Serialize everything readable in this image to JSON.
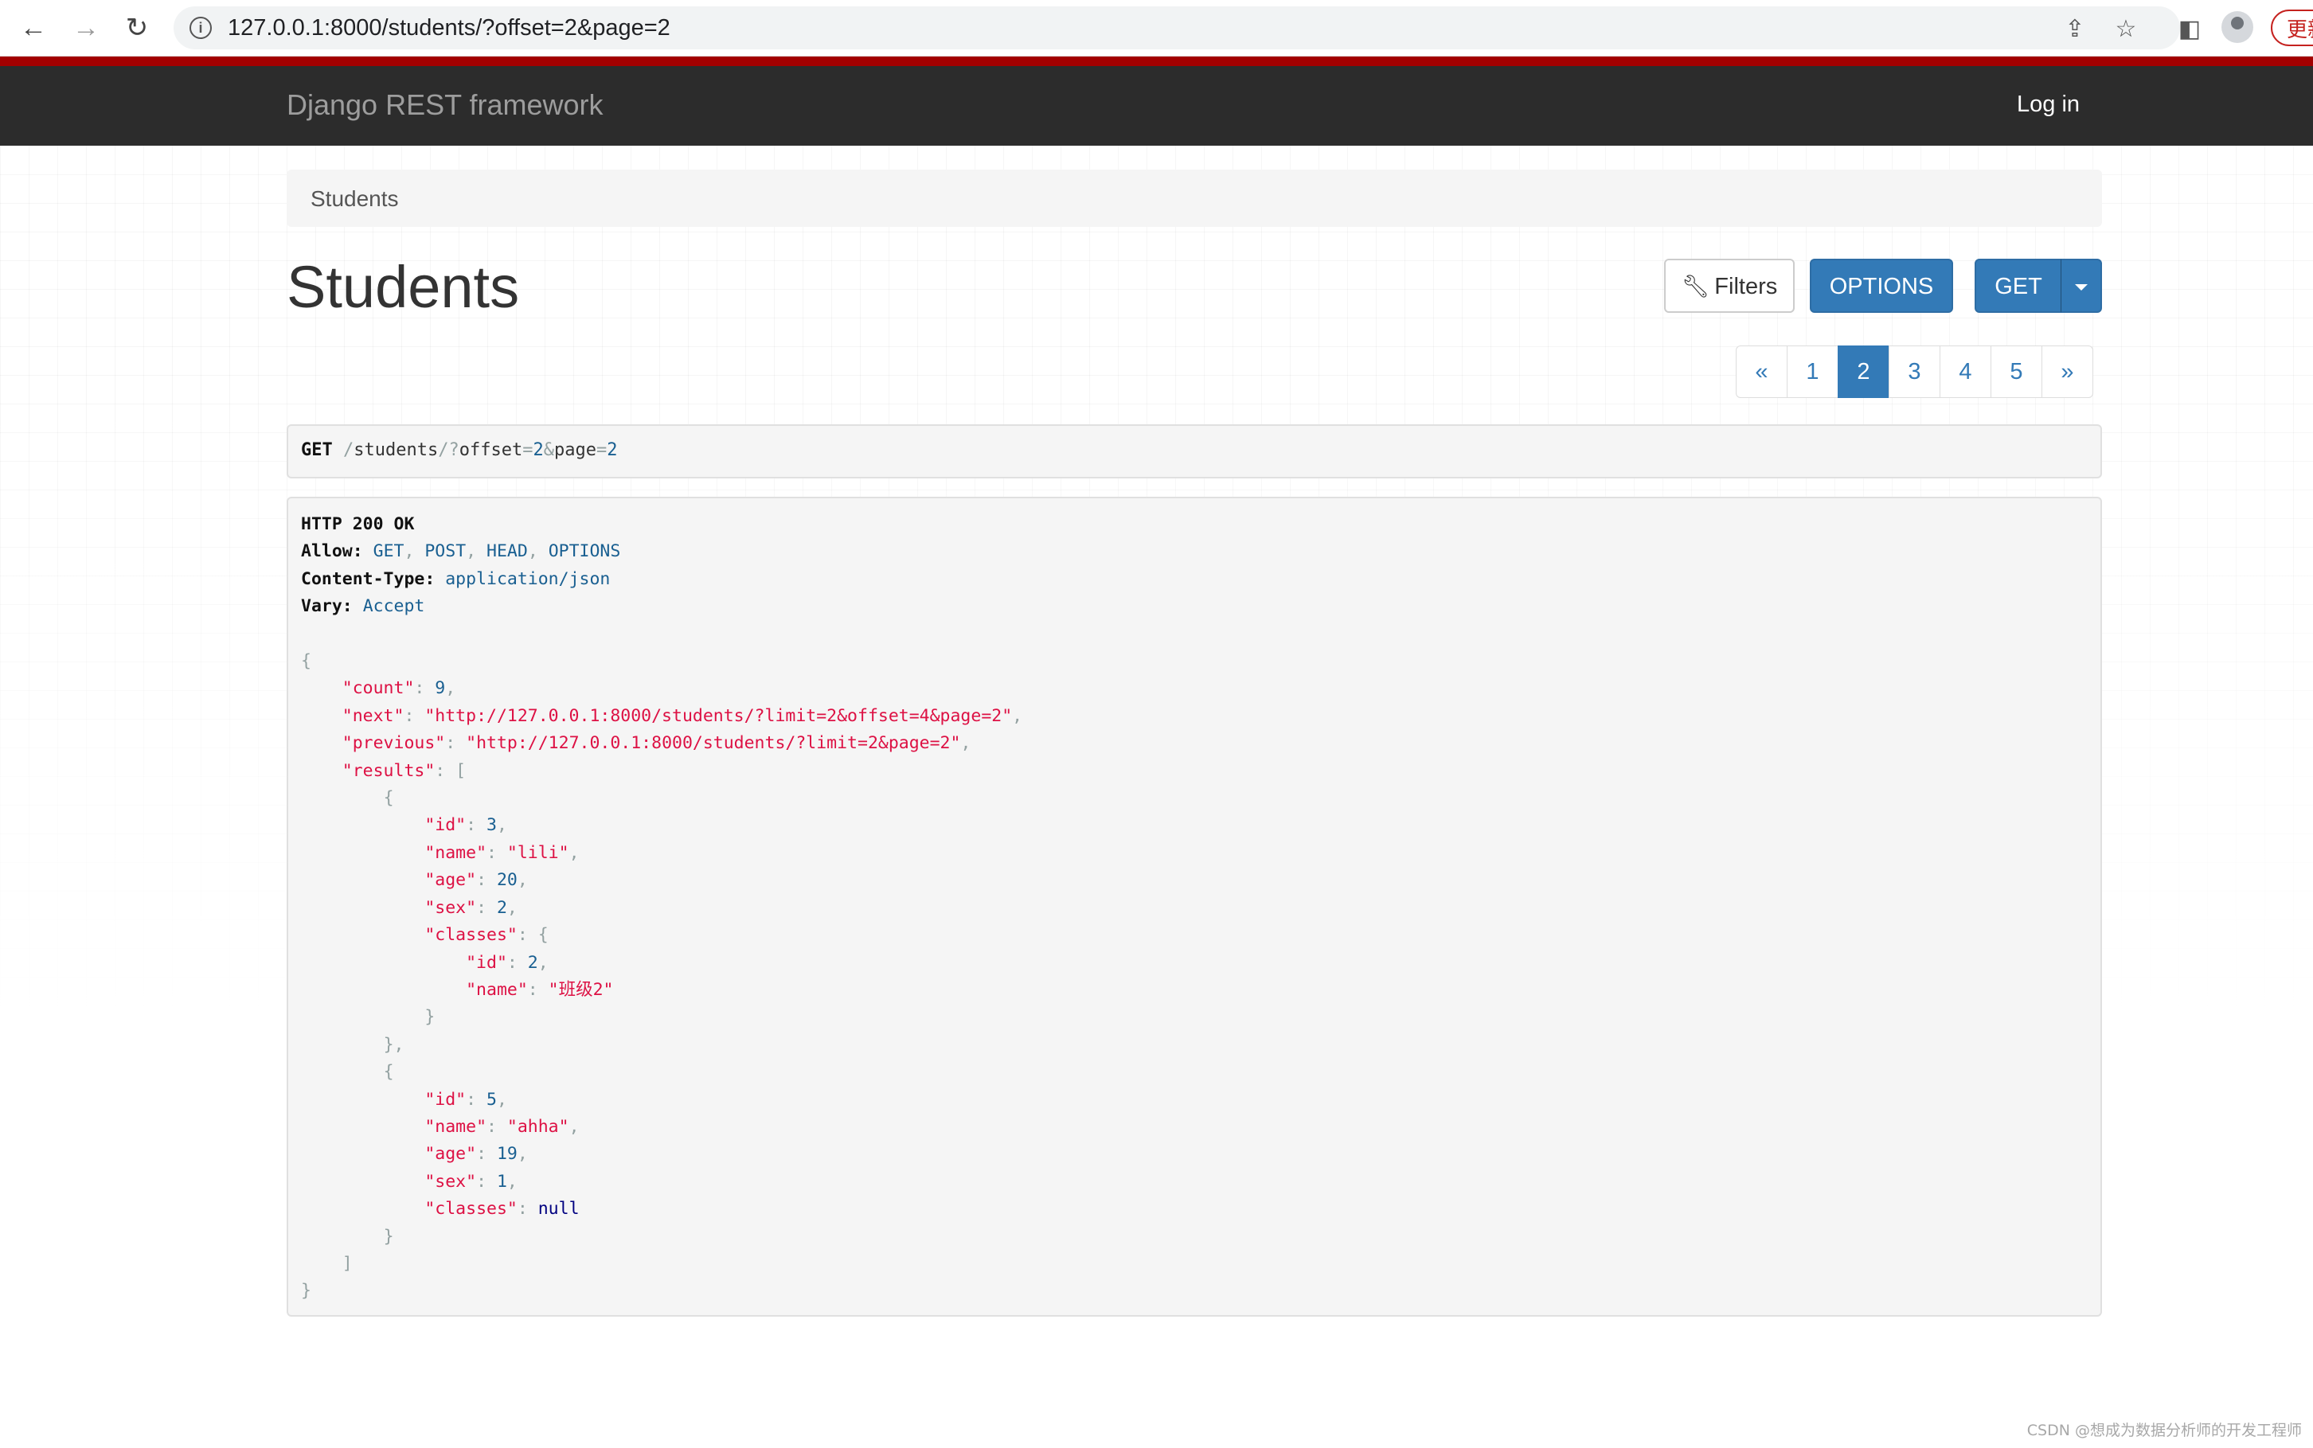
{
  "browser": {
    "url": "127.0.0.1:8000/students/?offset=2&page=2",
    "update_label": "更新"
  },
  "navbar": {
    "brand": "Django REST framework",
    "login": "Log in"
  },
  "breadcrumb": "Students",
  "page_title": "Students",
  "buttons": {
    "filters": "Filters",
    "options": "OPTIONS",
    "get": "GET"
  },
  "pagination": {
    "prev": "«",
    "pages": [
      "1",
      "2",
      "3",
      "4",
      "5"
    ],
    "active": "2",
    "next": "»"
  },
  "request": {
    "method": "GET",
    "path": "/students/?offset=2&page=2"
  },
  "response": {
    "status": "HTTP 200 OK",
    "headers": [
      {
        "name": "Allow:",
        "value": "GET, POST, HEAD, OPTIONS"
      },
      {
        "name": "Content-Type:",
        "value": "application/json"
      },
      {
        "name": "Vary:",
        "value": "Accept"
      }
    ],
    "body": {
      "count": 9,
      "next": "http://127.0.0.1:8000/students/?limit=2&offset=4&page=2",
      "previous": "http://127.0.0.1:8000/students/?limit=2&page=2",
      "results": [
        {
          "id": 3,
          "name": "lili",
          "age": 20,
          "sex": 2,
          "classes": {
            "id": 2,
            "name": "班级2"
          }
        },
        {
          "id": 5,
          "name": "ahha",
          "age": 19,
          "sex": 1,
          "classes": null
        }
      ]
    }
  },
  "watermark": "CSDN @想成为数据分析师的开发工程师",
  "colors": {
    "navbar": "#2c2c2c",
    "accent_red": "#a30000",
    "primary": "#337ab7",
    "json_string": "#dd1144",
    "json_number": "#195f91"
  }
}
